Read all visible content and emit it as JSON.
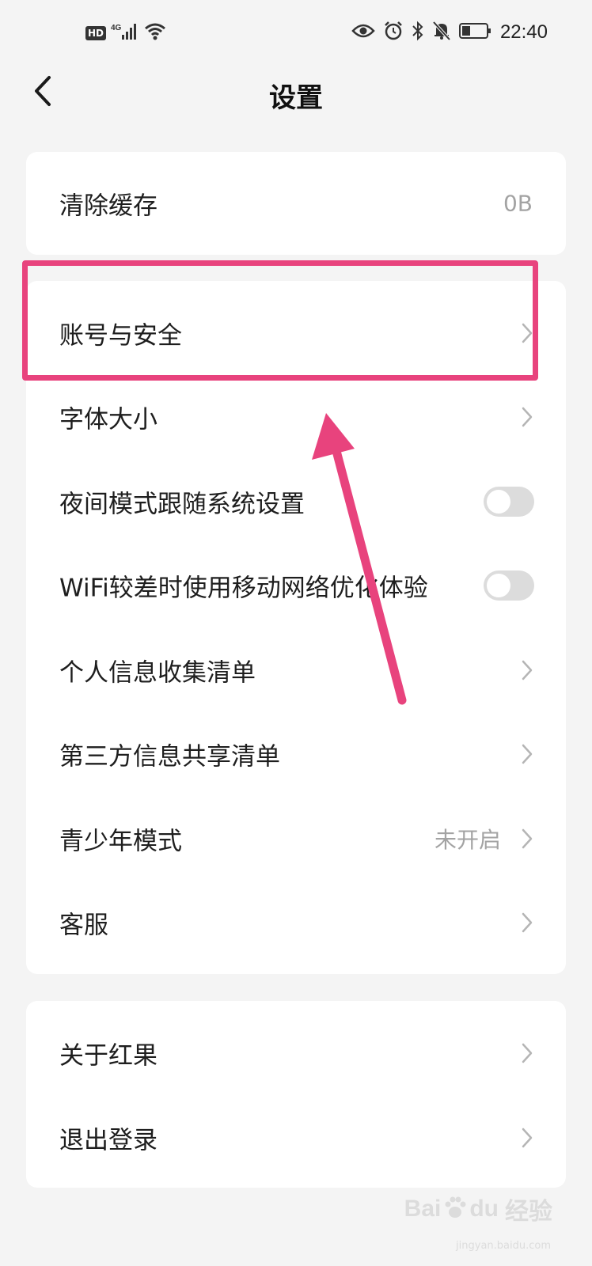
{
  "status_bar": {
    "hd_badge": "HD",
    "network": "4G",
    "time": "22:40",
    "icons": [
      "signal-icon",
      "wifi-icon",
      "eye-icon",
      "alarm-icon",
      "bluetooth-icon",
      "mute-icon",
      "battery-icon"
    ]
  },
  "header": {
    "title": "设置",
    "back_icon": "chevron-left-icon"
  },
  "group1": {
    "items": [
      {
        "label": "清除缓存",
        "value": "0B"
      }
    ]
  },
  "group2": {
    "items": [
      {
        "label": "账号与安全"
      },
      {
        "label": "字体大小"
      },
      {
        "label": "夜间模式跟随系统设置",
        "toggle": false
      },
      {
        "label": "WiFi较差时使用移动网络优化体验",
        "toggle": false
      },
      {
        "label": "个人信息收集清单"
      },
      {
        "label": "第三方信息共享清单"
      },
      {
        "label": "青少年模式",
        "value": "未开启"
      },
      {
        "label": "客服"
      }
    ]
  },
  "group3": {
    "items": [
      {
        "label": "关于红果"
      },
      {
        "label": "退出登录"
      }
    ]
  },
  "annotation": {
    "color": "#e8437d"
  },
  "watermark": {
    "text": "Bai",
    "text2": "du",
    "text3": "经验",
    "sub": "jingyan.baidu.com"
  },
  "colors": {
    "background": "#f4f4f4",
    "card": "#ffffff",
    "secondary_text": "#a3a3a3",
    "toggle_off": "#dcdcdc"
  }
}
